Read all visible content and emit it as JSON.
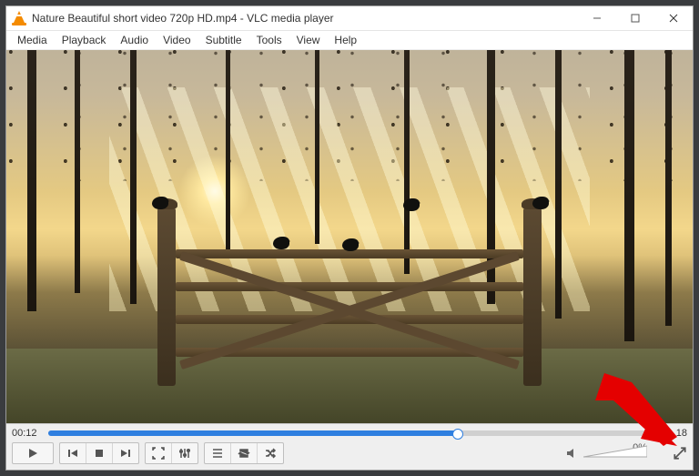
{
  "title": "Nature Beautiful short video 720p HD.mp4 - VLC media player",
  "menu": [
    "Media",
    "Playback",
    "Audio",
    "Video",
    "Subtitle",
    "Tools",
    "View",
    "Help"
  ],
  "time": {
    "elapsed": "00:12",
    "total": "18"
  },
  "seek": {
    "percent": 68
  },
  "volume": {
    "percent_label": "0%",
    "percent": 0,
    "muted": false
  },
  "icons": {
    "play": "play-icon",
    "prev": "skip-previous-icon",
    "stop": "stop-icon",
    "next": "skip-next-icon",
    "fullscreen": "fullscreen-icon",
    "ext": "extended-settings-icon",
    "playlist": "playlist-icon",
    "loop": "loop-icon",
    "shuffle": "shuffle-icon",
    "speaker": "speaker-icon",
    "expand": "expand-icon",
    "minimize": "minimize-icon",
    "maximize": "maximize-icon",
    "close": "close-icon"
  }
}
